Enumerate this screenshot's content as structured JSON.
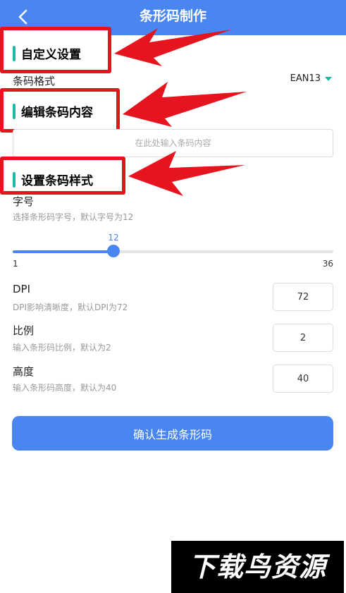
{
  "header": {
    "title": "条形码制作"
  },
  "sections": {
    "custom_settings": "自定义设置",
    "edit_content": "编辑条码内容",
    "style_settings": "设置条码样式"
  },
  "format": {
    "label": "条码格式",
    "value": "EAN13"
  },
  "content": {
    "placeholder": "在此处输入条码内容"
  },
  "font_size": {
    "label": "字号",
    "hint": "选择条形码字号，默认字号为12",
    "value": 12,
    "value_text": "12",
    "min": "1",
    "max": "36"
  },
  "dpi": {
    "label": "DPI",
    "hint": "DPI影响清晰度，默认DPI为72",
    "value": "72"
  },
  "ratio": {
    "label": "比例",
    "hint": "输入条形码比例，默认为2",
    "value": "2"
  },
  "height": {
    "label": "高度",
    "hint": "输入条形码高度，默认为40",
    "value": "40"
  },
  "submit": {
    "label": "确认生成条形码"
  },
  "watermark": {
    "text": "下载鸟资源"
  },
  "colors": {
    "primary": "#4a86f0",
    "accent": "#1fb8a6",
    "annotation": "#e5141e"
  },
  "icons": {
    "back": "chevron-left-icon",
    "dropdown": "caret-down-icon"
  }
}
